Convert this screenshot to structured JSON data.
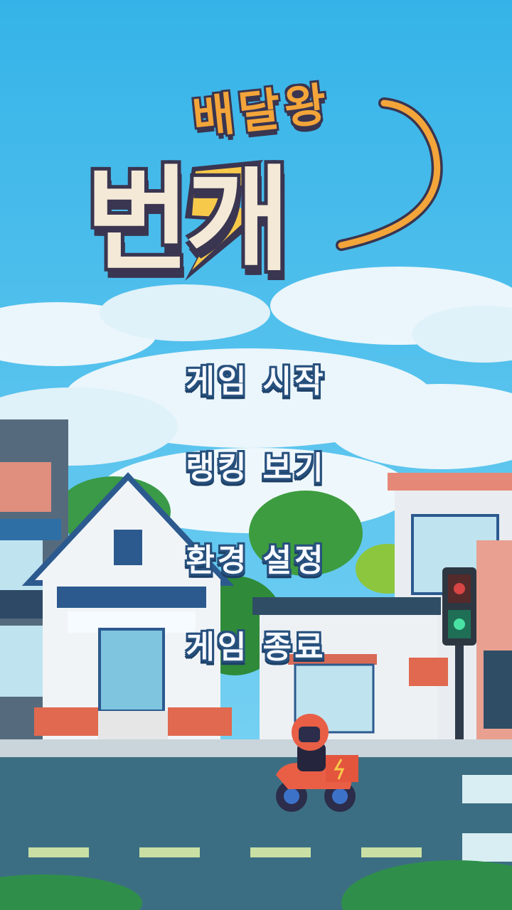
{
  "logo": {
    "top_text": "배달왕",
    "main_text": "번개",
    "colors": {
      "cream": "#f3e9d6",
      "outline": "#3a3550",
      "orange": "#f3a53a",
      "bolt": "#f7c94a"
    }
  },
  "menu": {
    "items": [
      {
        "id": "start",
        "label": "게임 시작"
      },
      {
        "id": "ranking",
        "label": "랭킹 보기"
      },
      {
        "id": "settings",
        "label": "환경 설정"
      },
      {
        "id": "quit",
        "label": "게임 종료"
      }
    ]
  },
  "palette": {
    "sky": "#3fb6e6",
    "road": "#3c6e83",
    "menu_text": "#f6f9ff",
    "menu_outline": "#27507d"
  }
}
